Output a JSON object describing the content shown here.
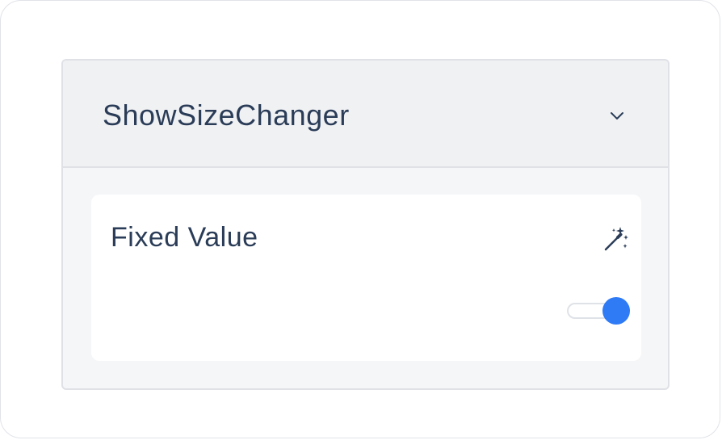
{
  "panel": {
    "title": "ShowSizeChanger",
    "expanded": true,
    "chevron_icon": "chevron-down-icon"
  },
  "field": {
    "label": "Fixed Value",
    "wand_icon": "magic-wand-icon",
    "toggle": {
      "on": true,
      "accent_color": "#2f7bf6"
    }
  }
}
